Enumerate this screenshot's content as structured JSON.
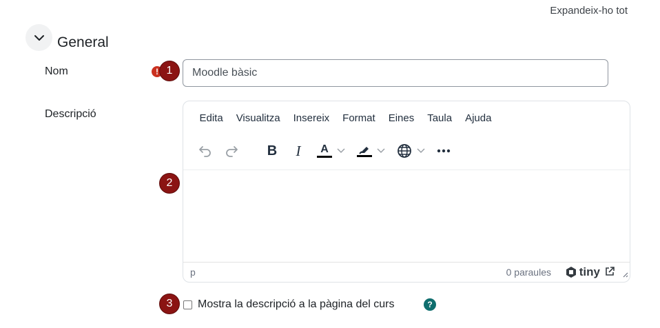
{
  "header": {
    "expand_all_label": "Expandeix-ho tot"
  },
  "section": {
    "title": "General",
    "toggle_icon": "chevron-down-icon"
  },
  "fields": {
    "name": {
      "label": "Nom",
      "value": "Moodle bàsic",
      "required_icon": "exclamation-icon",
      "required_mark": "!"
    },
    "description": {
      "label": "Descripció"
    }
  },
  "editor": {
    "menu": [
      "Edita",
      "Visualitza",
      "Insereix",
      "Format",
      "Eines",
      "Taula",
      "Ajuda"
    ],
    "toolbar_icons": [
      "undo-icon",
      "redo-icon",
      "bold-icon",
      "italic-icon",
      "text-color-icon",
      "highlight-color-icon",
      "language-icon",
      "more-icon"
    ],
    "bold_glyph": "B",
    "italic_glyph": "I",
    "text_color_glyph": "A",
    "status": {
      "path": "p",
      "word_count": "0 paraules",
      "brand": "tiny"
    },
    "colors": {
      "text_color_bar": "#000000",
      "highlight_bar": "#000000"
    }
  },
  "show_description": {
    "label": "Mostra la descripció a la pàgina del curs",
    "checked": false,
    "help_icon": "question-icon",
    "help_glyph": "?"
  },
  "steps": {
    "one": "1",
    "two": "2",
    "three": "3"
  },
  "colors": {
    "step_badge": "#8b1413",
    "required": "#ca3120",
    "help": "#0f6e6e"
  }
}
